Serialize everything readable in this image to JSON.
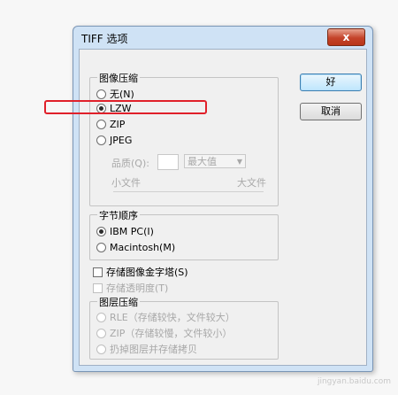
{
  "window": {
    "title": "TIFF 选项",
    "close_label": "x"
  },
  "image_compression": {
    "legend": "图像压缩",
    "options": [
      {
        "label": "无(N)",
        "selected": false
      },
      {
        "label": "LZW",
        "selected": true
      },
      {
        "label": "ZIP",
        "selected": false
      },
      {
        "label": "JPEG",
        "selected": false
      }
    ],
    "quality_label": "品质(Q):",
    "quality_value": "",
    "quality_select": "最大值",
    "slider_min": "小文件",
    "slider_max": "大文件"
  },
  "buttons": {
    "ok": "好",
    "cancel": "取消"
  },
  "byte_order": {
    "legend": "字节顺序",
    "options": [
      {
        "label": "IBM PC(I)",
        "selected": true
      },
      {
        "label": "Macintosh(M)",
        "selected": false
      }
    ]
  },
  "checkboxes": {
    "save_pyramid": "存储图像金字塔(S)",
    "save_transparency": "存储透明度(T)"
  },
  "layer_compression": {
    "legend": "图层压缩",
    "options": [
      {
        "label": "RLE（存储较快，文件较大）",
        "selected": false
      },
      {
        "label": "ZIP（存储较慢，文件较小）",
        "selected": false
      },
      {
        "label": "扔掉图层并存储拷贝",
        "selected": false
      }
    ]
  },
  "watermark": "jingyan.baidu.com",
  "colors": {
    "title_bg": "#cfe2f5",
    "highlight": "#e0202a",
    "close_button": "#c4432a"
  }
}
